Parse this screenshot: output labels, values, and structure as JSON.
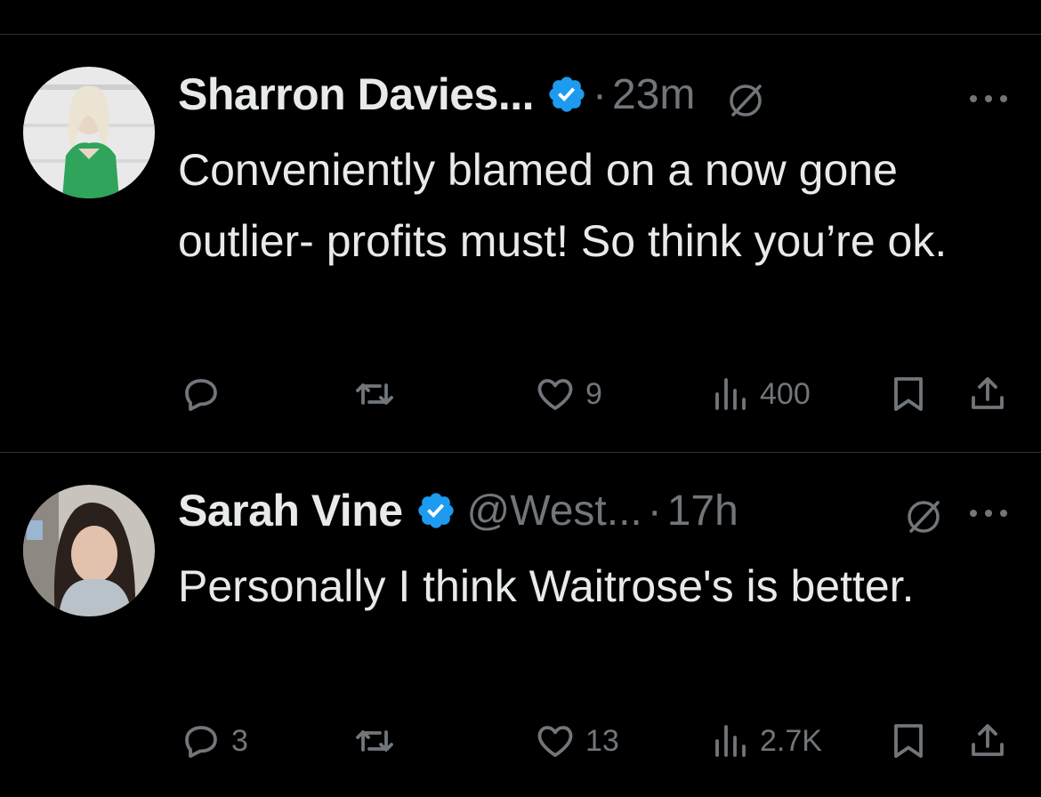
{
  "colors": {
    "background": "#000000",
    "text": "#e7e9ea",
    "muted": "#71767b",
    "divider": "#2f3336",
    "verified_blue": "#1d9bf0"
  },
  "tweets": [
    {
      "name": "Sharron Davies...",
      "handle": "",
      "time": "23m",
      "separator": "·",
      "text": "Conveniently blamed on a now gone outlier- profits must! So think you’re ok.",
      "replies": "",
      "retweets": "",
      "likes": "9",
      "views": "400",
      "icons": [
        "verified-badge-icon",
        "grok-icon",
        "more-icon",
        "reply-icon",
        "retweet-icon",
        "like-icon",
        "views-icon",
        "bookmark-icon",
        "share-icon"
      ]
    },
    {
      "name": "Sarah Vine",
      "handle": "@West...",
      "time": "17h",
      "separator": "·",
      "text": "Personally I think Waitrose's is better.",
      "replies": "3",
      "retweets": "",
      "likes": "13",
      "views": "2.7K",
      "icons": [
        "verified-badge-icon",
        "grok-icon",
        "more-icon",
        "reply-icon",
        "retweet-icon",
        "like-icon",
        "views-icon",
        "bookmark-icon",
        "share-icon"
      ]
    }
  ]
}
